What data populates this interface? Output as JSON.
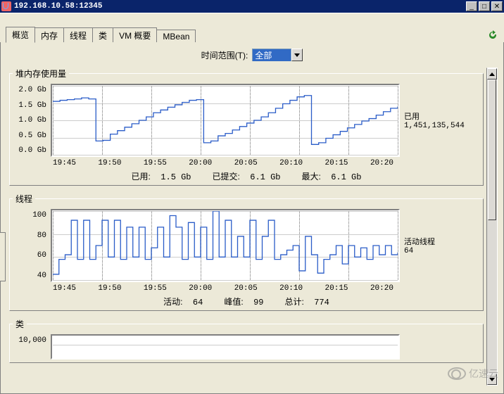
{
  "window": {
    "title": "192.168.10.58:12345"
  },
  "tabs": [
    "概览",
    "内存",
    "线程",
    "类",
    "VM 概要",
    "MBean"
  ],
  "active_tab_index": 0,
  "timerange": {
    "label": "时间范围(T):",
    "selected": "全部"
  },
  "chart_data": [
    {
      "id": "heap",
      "title": "堆内存使用量",
      "type": "line",
      "y_ticks": [
        "2.0 Gb",
        "1.5 Gb",
        "1.0 Gb",
        "0.5 Gb",
        "0.0 Gb"
      ],
      "ylim": [
        0,
        2.0
      ],
      "x_ticks": [
        "19:45",
        "19:50",
        "19:55",
        "20:00",
        "20:05",
        "20:10",
        "20:15",
        "20:20"
      ],
      "side_label": "已用",
      "side_value": "1,451,135,544",
      "series": [
        {
          "name": "used",
          "color": "#2a5cc8",
          "values": [
            1.55,
            1.58,
            1.6,
            1.62,
            1.65,
            1.62,
            0.4,
            0.42,
            0.6,
            0.7,
            0.8,
            0.9,
            1.0,
            1.1,
            1.22,
            1.3,
            1.38,
            1.45,
            1.52,
            1.58,
            1.6,
            0.35,
            0.4,
            0.55,
            0.62,
            0.72,
            0.82,
            0.92,
            1.0,
            1.1,
            1.22,
            1.35,
            1.48,
            1.58,
            1.68,
            1.72,
            0.3,
            0.35,
            0.48,
            0.58,
            0.68,
            0.78,
            0.88,
            0.98,
            1.05,
            1.15,
            1.25,
            1.35,
            1.4
          ]
        }
      ],
      "stats": {
        "used_label": "已用:",
        "used": "1.5 Gb",
        "committed_label": "已提交:",
        "committed": "6.1 Gb",
        "max_label": "最大:",
        "max": "6.1 Gb"
      }
    },
    {
      "id": "threads",
      "title": "线程",
      "type": "line",
      "y_ticks": [
        "100",
        "80",
        "60",
        "40"
      ],
      "ylim": [
        40,
        100
      ],
      "x_ticks": [
        "19:45",
        "19:50",
        "19:55",
        "20:00",
        "20:05",
        "20:10",
        "20:15",
        "20:20"
      ],
      "side_label": "活动线程",
      "side_value": "64",
      "series": [
        {
          "name": "live",
          "color": "#2a5cc8",
          "values": [
            45,
            58,
            62,
            92,
            58,
            92,
            58,
            70,
            92,
            60,
            92,
            58,
            86,
            60,
            86,
            58,
            68,
            86,
            60,
            96,
            86,
            58,
            90,
            60,
            86,
            58,
            100,
            60,
            92,
            60,
            78,
            60,
            92,
            58,
            78,
            92,
            58,
            62,
            66,
            70,
            48,
            78,
            62,
            46,
            58,
            62,
            70,
            54,
            70,
            60,
            68,
            58,
            70,
            62,
            70,
            62,
            64
          ]
        }
      ],
      "stats": {
        "live_label": "活动:",
        "live": "64",
        "peak_label": "峰值:",
        "peak": "99",
        "total_label": "总计:",
        "total": "774"
      }
    },
    {
      "id": "classes",
      "title": "类",
      "type": "line",
      "y_ticks": [
        "10,000"
      ],
      "ylim": [
        9000,
        11000
      ],
      "x_ticks": [],
      "series": [],
      "stats": {}
    }
  ],
  "watermark": "亿速云"
}
